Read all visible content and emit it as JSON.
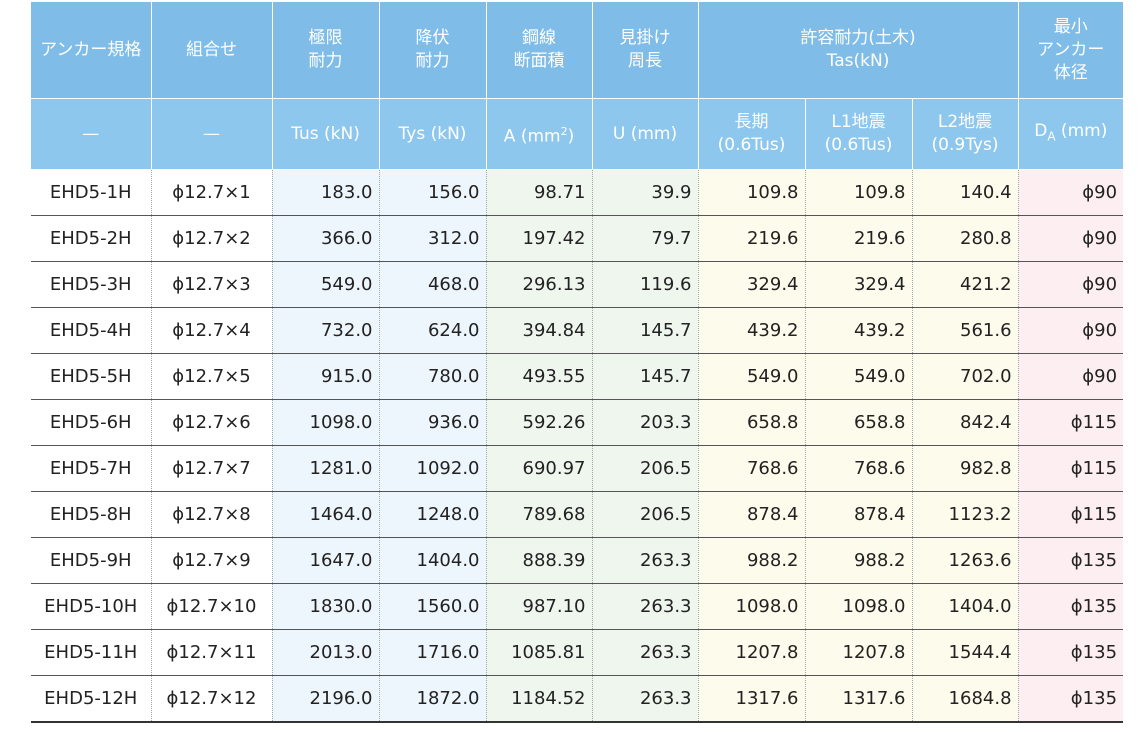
{
  "header": {
    "spec": "アンカー規格",
    "comb": "組合せ",
    "tus_line1": "極限",
    "tus_line2": "耐力",
    "tys_line1": "降伏",
    "tys_line2": "耐力",
    "area_line1": "鋼線",
    "area_line2": "断面積",
    "u_line1": "見掛け",
    "u_line2": "周長",
    "tas_line1": "許容耐力(土木)",
    "tas_line2": "Tas(kN)",
    "da_line1": "最小",
    "da_line2": "アンカー",
    "da_line3": "体径"
  },
  "units": {
    "spec": "—",
    "comb": "—",
    "tus": "Tus (kN)",
    "tys": "Tys (kN)",
    "area_prefix": "A (mm",
    "area_sup": "2",
    "area_suffix": ")",
    "u": "U (mm)",
    "long_line1": "長期",
    "long_line2": "(0.6Tus)",
    "l1_line1": "L1地震",
    "l1_line2": "(0.6Tus)",
    "l2_line1": "L2地震",
    "l2_line2": "(0.9Tys)",
    "da_prefix": "D",
    "da_sub": "A",
    "da_suffix": " (mm)"
  },
  "rows": [
    {
      "spec": "EHD5-1H",
      "comb": "ϕ12.7×1",
      "tus": "183.0",
      "tys": "156.0",
      "area": "98.71",
      "u": "39.9",
      "long": "109.8",
      "l1": "109.8",
      "l2": "140.4",
      "da": "ϕ90"
    },
    {
      "spec": "EHD5-2H",
      "comb": "ϕ12.7×2",
      "tus": "366.0",
      "tys": "312.0",
      "area": "197.42",
      "u": "79.7",
      "long": "219.6",
      "l1": "219.6",
      "l2": "280.8",
      "da": "ϕ90"
    },
    {
      "spec": "EHD5-3H",
      "comb": "ϕ12.7×3",
      "tus": "549.0",
      "tys": "468.0",
      "area": "296.13",
      "u": "119.6",
      "long": "329.4",
      "l1": "329.4",
      "l2": "421.2",
      "da": "ϕ90"
    },
    {
      "spec": "EHD5-4H",
      "comb": "ϕ12.7×4",
      "tus": "732.0",
      "tys": "624.0",
      "area": "394.84",
      "u": "145.7",
      "long": "439.2",
      "l1": "439.2",
      "l2": "561.6",
      "da": "ϕ90"
    },
    {
      "spec": "EHD5-5H",
      "comb": "ϕ12.7×5",
      "tus": "915.0",
      "tys": "780.0",
      "area": "493.55",
      "u": "145.7",
      "long": "549.0",
      "l1": "549.0",
      "l2": "702.0",
      "da": "ϕ90"
    },
    {
      "spec": "EHD5-6H",
      "comb": "ϕ12.7×6",
      "tus": "1098.0",
      "tys": "936.0",
      "area": "592.26",
      "u": "203.3",
      "long": "658.8",
      "l1": "658.8",
      "l2": "842.4",
      "da": "ϕ115"
    },
    {
      "spec": "EHD5-7H",
      "comb": "ϕ12.7×7",
      "tus": "1281.0",
      "tys": "1092.0",
      "area": "690.97",
      "u": "206.5",
      "long": "768.6",
      "l1": "768.6",
      "l2": "982.8",
      "da": "ϕ115"
    },
    {
      "spec": "EHD5-8H",
      "comb": "ϕ12.7×8",
      "tus": "1464.0",
      "tys": "1248.0",
      "area": "789.68",
      "u": "206.5",
      "long": "878.4",
      "l1": "878.4",
      "l2": "1123.2",
      "da": "ϕ115"
    },
    {
      "spec": "EHD5-9H",
      "comb": "ϕ12.7×9",
      "tus": "1647.0",
      "tys": "1404.0",
      "area": "888.39",
      "u": "263.3",
      "long": "988.2",
      "l1": "988.2",
      "l2": "1263.6",
      "da": "ϕ135"
    },
    {
      "spec": "EHD5-10H",
      "comb": "ϕ12.7×10",
      "tus": "1830.0",
      "tys": "1560.0",
      "area": "987.10",
      "u": "263.3",
      "long": "1098.0",
      "l1": "1098.0",
      "l2": "1404.0",
      "da": "ϕ135"
    },
    {
      "spec": "EHD5-11H",
      "comb": "ϕ12.7×11",
      "tus": "2013.0",
      "tys": "1716.0",
      "area": "1085.81",
      "u": "263.3",
      "long": "1207.8",
      "l1": "1207.8",
      "l2": "1544.4",
      "da": "ϕ135"
    },
    {
      "spec": "EHD5-12H",
      "comb": "ϕ12.7×12",
      "tus": "2196.0",
      "tys": "1872.0",
      "area": "1184.52",
      "u": "263.3",
      "long": "1317.6",
      "l1": "1317.6",
      "l2": "1684.8",
      "da": "ϕ135"
    }
  ],
  "colors": {
    "header_bg": "#7fbde8",
    "header_text": "#ffffff",
    "load_cols_bg": "#eef6fd",
    "section_cols_bg": "#eef6ee",
    "allowable_cols_bg": "#fdfbeb",
    "diameter_col_bg": "#fdeef2"
  }
}
